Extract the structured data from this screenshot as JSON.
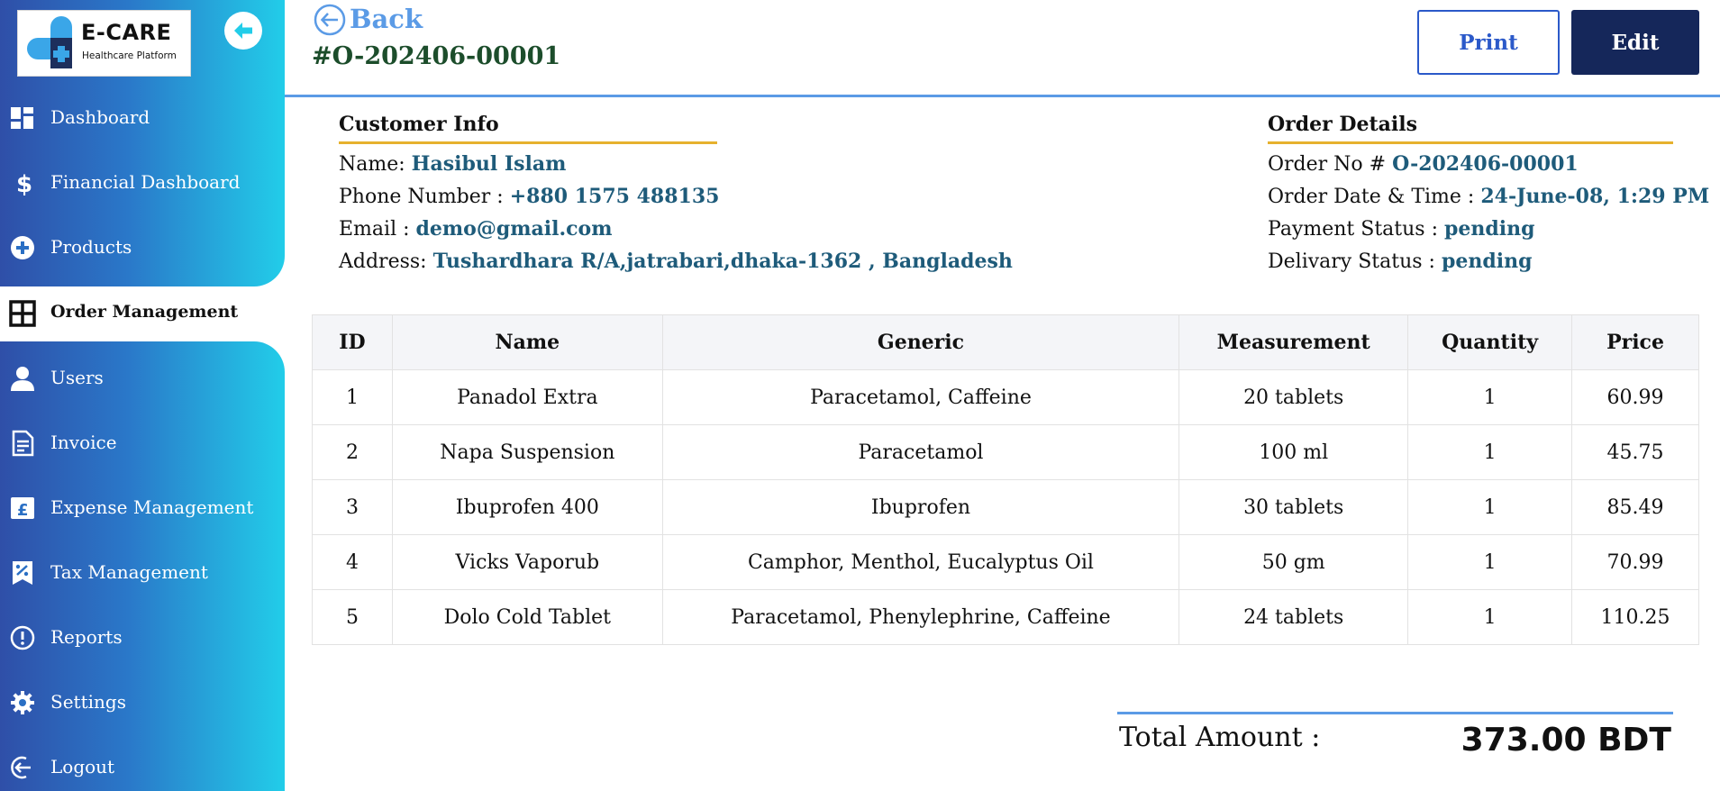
{
  "brand": {
    "title": "E-CARE",
    "subtitle": "Healthcare Platform"
  },
  "sidebar": {
    "items": [
      {
        "label": "Dashboard",
        "icon": "dashboard-icon"
      },
      {
        "label": "Financial Dashboard",
        "icon": "dollar-icon"
      },
      {
        "label": "Products",
        "icon": "plus-circle-icon"
      },
      {
        "label": "Order Management",
        "icon": "grid-icon",
        "active": true
      },
      {
        "label": "Users",
        "icon": "user-icon"
      },
      {
        "label": "Invoice",
        "icon": "invoice-icon"
      },
      {
        "label": "Expense Management",
        "icon": "pound-icon"
      },
      {
        "label": "Tax Management",
        "icon": "tax-icon"
      },
      {
        "label": "Reports",
        "icon": "alert-circle-icon"
      },
      {
        "label": "Settings",
        "icon": "gear-icon"
      },
      {
        "label": "Logout",
        "icon": "logout-icon"
      }
    ]
  },
  "header": {
    "back_label": "Back",
    "order_code": "#O-202406-00001",
    "print_label": "Print",
    "edit_label": "Edit"
  },
  "customer": {
    "heading": "Customer Info",
    "name_label": "Name:",
    "name": "Hasibul Islam",
    "phone_label": "Phone Number :",
    "phone": "+880 1575 488135",
    "email_label": "Email :",
    "email": "demo@gmail.com",
    "address_label": "Address:",
    "address": "Tushardhara R/A,jatrabari,dhaka-1362 , Bangladesh"
  },
  "order": {
    "heading": "Order Details",
    "no_label": "Order No #",
    "no": "O-202406-00001",
    "datetime_label": "Order Date & Time :",
    "datetime": "24-June-08, 1:29 PM",
    "payment_label": "Payment Status :",
    "payment": "pending",
    "delivery_label": "Delivary Status :",
    "delivery": "pending"
  },
  "table": {
    "columns": [
      "ID",
      "Name",
      "Generic",
      "Measurement",
      "Quantity",
      "Price"
    ],
    "rows": [
      [
        "1",
        "Panadol Extra",
        "Paracetamol, Caffeine",
        "20 tablets",
        "1",
        "60.99"
      ],
      [
        "2",
        "Napa Suspension",
        "Paracetamol",
        "100 ml",
        "1",
        "45.75"
      ],
      [
        "3",
        "Ibuprofen 400",
        "Ibuprofen",
        "30 tablets",
        "1",
        "85.49"
      ],
      [
        "4",
        "Vicks Vaporub",
        "Camphor, Menthol, Eucalyptus Oil",
        "50 gm",
        "1",
        "70.99"
      ],
      [
        "5",
        "Dolo Cold Tablet",
        "Paracetamol, Phenylephrine, Caffeine",
        "24 tablets",
        "1",
        "110.25"
      ]
    ]
  },
  "total": {
    "label": "Total Amount :",
    "value": "373.00 BDT"
  },
  "colors": {
    "accent": "#5b9be6",
    "underline": "#e6b12e",
    "value_text": "#1e5b7a",
    "edit_bg": "#15275a"
  }
}
